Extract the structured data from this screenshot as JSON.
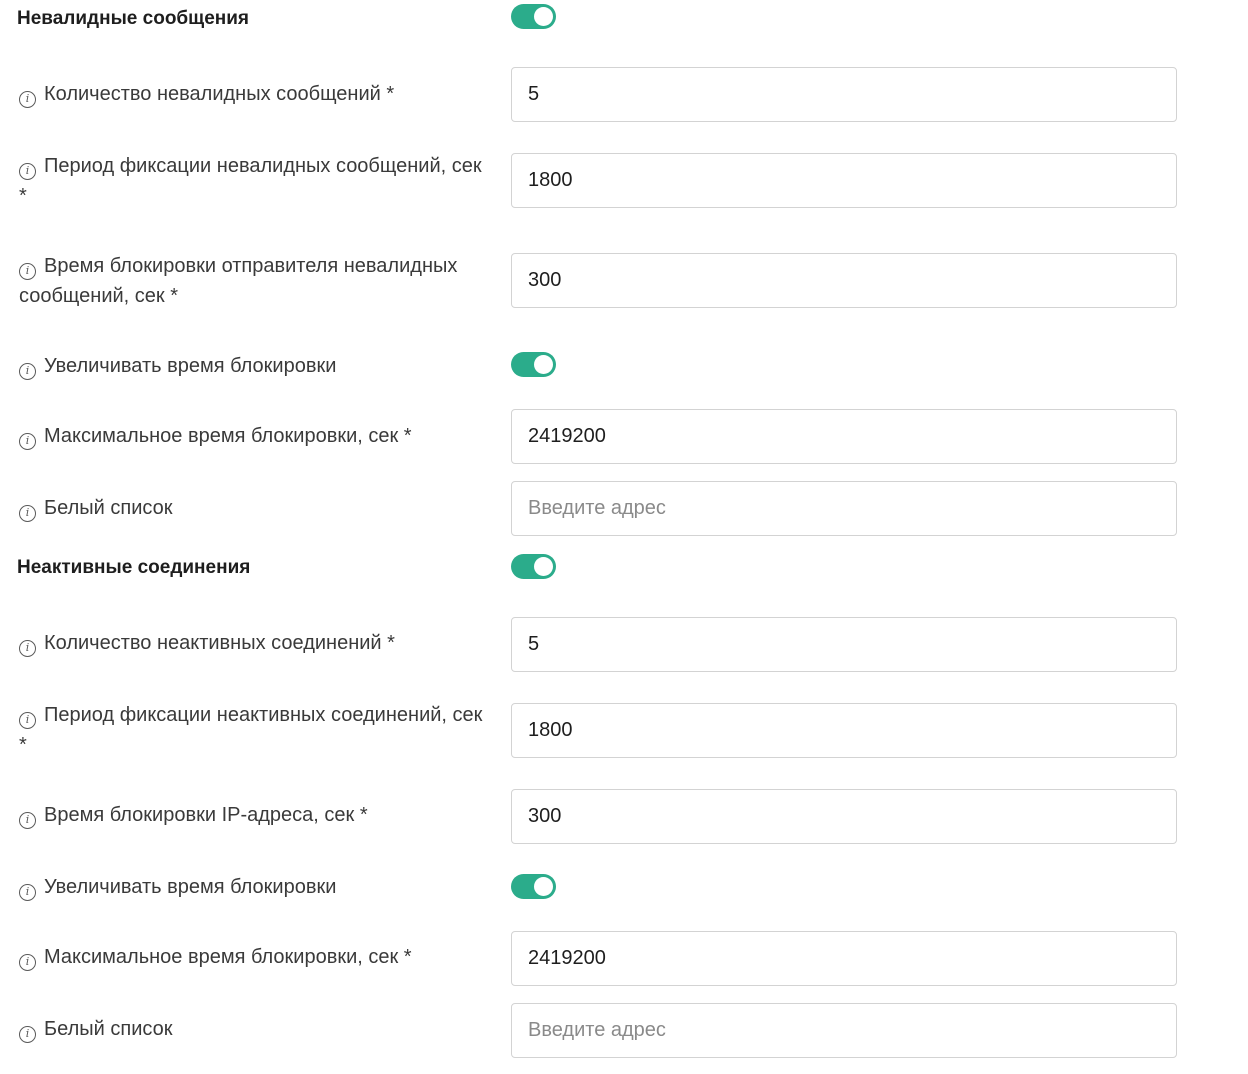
{
  "colors": {
    "accent": "#2bac8b",
    "border": "#d3d3d3"
  },
  "sections": [
    {
      "title": "Невалидные сообщения",
      "enabled": true,
      "rows": [
        {
          "label": "Количество невалидных сообщений *",
          "value": "5"
        },
        {
          "label": "Период фиксации невалидных сообщений, сек *",
          "value": "1800"
        },
        {
          "label": "Время блокировки отправителя невалидных сообщений, сек *",
          "value": "300"
        },
        {
          "label": "Увеличивать время блокировки",
          "toggle": true
        },
        {
          "label": "Максимальное время блокировки, сек *",
          "value": "2419200"
        },
        {
          "label": "Белый список",
          "value": "",
          "placeholder": "Введите адрес"
        }
      ]
    },
    {
      "title": "Неактивные соединения",
      "enabled": true,
      "rows": [
        {
          "label": "Количество неактивных соединений *",
          "value": "5"
        },
        {
          "label": "Период фиксации неактивных соединений, сек *",
          "value": "1800"
        },
        {
          "label": "Время блокировки IP-адреса, сек *",
          "value": "300"
        },
        {
          "label": "Увеличивать время блокировки",
          "toggle": true
        },
        {
          "label": "Максимальное время блокировки, сек *",
          "value": "2419200"
        },
        {
          "label": "Белый список",
          "value": "",
          "placeholder": "Введите адрес"
        }
      ]
    }
  ]
}
